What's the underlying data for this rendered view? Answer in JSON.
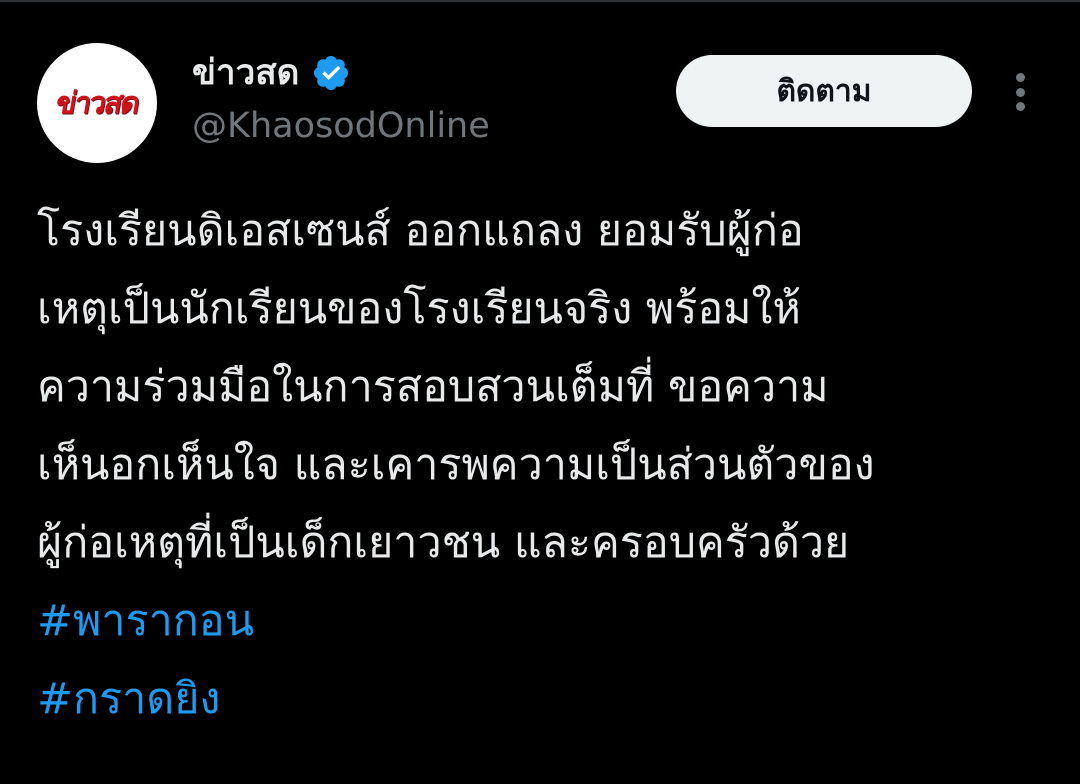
{
  "account": {
    "display_name": "ข่าวสด",
    "handle": "@KhaosodOnline",
    "avatar_logo_text": "ข่าวสด",
    "verified": true
  },
  "actions": {
    "follow_label": "ติดตาม",
    "more_icon": "more-vertical-icon"
  },
  "tweet": {
    "lines": [
      "โรงเรียนดิเอสเซนส์ ออกแถลง ยอมรับผู้ก่อ",
      "เหตุเป็นนักเรียนของโรงเรียนจริง พร้อมให้",
      "ความร่วมมือในการสอบสวนเต็มที่ ขอความ",
      "เห็นอกเห็นใจ และเคารพความเป็นส่วนตัวของ",
      "ผู้ก่อเหตุที่เป็นเด็กเยาวชน และครอบครัวด้วย"
    ],
    "hashtags": [
      "#พารากอน",
      "#กราดยิง"
    ]
  },
  "colors": {
    "background": "#000000",
    "text_primary": "#e7e9ea",
    "text_secondary": "#71767b",
    "link": "#1d9bf0",
    "verified_badge": "#1d9bf0",
    "follow_button_bg": "#eff3f4",
    "avatar_logo": "#d0121b"
  }
}
